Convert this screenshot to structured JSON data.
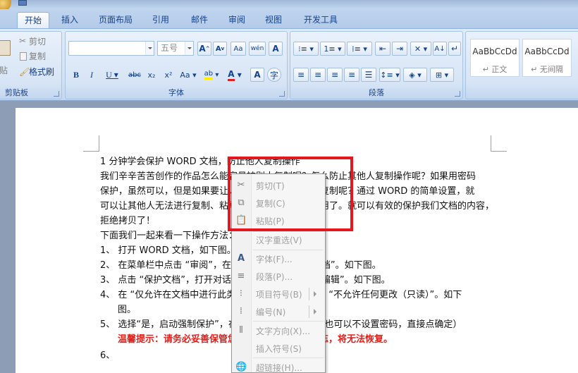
{
  "tabs": [
    {
      "label": "开始",
      "active": true
    },
    {
      "label": "插入"
    },
    {
      "label": "页面布局"
    },
    {
      "label": "引用"
    },
    {
      "label": "邮件"
    },
    {
      "label": "审阅"
    },
    {
      "label": "视图"
    },
    {
      "label": "开发工具"
    }
  ],
  "ribbon": {
    "clipboard": {
      "group_label": "剪贴板",
      "paste_label": "粘贴",
      "cut": "剪切",
      "copy": "复制",
      "format_painter": "格式刷"
    },
    "font": {
      "group_label": "字体",
      "font_name": "",
      "font_size": "五号"
    },
    "paragraph": {
      "group_label": "段落"
    },
    "styles": {
      "normal_preview": "AaBbCcDd",
      "normal_label": "↵ 正文",
      "nospace_preview": "AaBbCcDd",
      "nospace_label": "↵ 无间隔"
    }
  },
  "document": {
    "lines": [
      "1 分钟学会保护 WORD 文档，防止他人复制操作",
      "我们辛辛苦苦创作的作品怎么能容易被别人复制呢？怎么防止其他人复制操作呢？如果用密码",
      "保护，虽然可以，但是如果要让人阅读，但又不允许其复制呢？通过 WORD 的简单设置，就",
      "可以让其他人无法进行复制、粘贴等操作，非常方便实用了。就可以有效的保护我们文档的内容，",
      "拒绝拷贝了！",
      "下面我们一起来看一下操作方法：",
      "1、 打开 WORD 文档，如下图。",
      "2、 在菜单栏中点击 “审阅”，在工具栏中点击 “保护文档”。如下图。",
      "3、 点击 “保护文档”，打开对话框，选择 “限制格式和编辑”。如下图。",
      "4、 在 “仅允许在文档中进行此类编辑” 下拉菜单中选择 “不允许任何更改（只读）”。如下",
      "图。",
      "5、 选择“是，启动强制保护”，在对话框中输入密码。（也可以不设置密码，直接点确定）",
      "温馨提示：请务必妥善保管您设置的密码，如果遗忘，将无法恢复。",
      "6、"
    ]
  },
  "context_menu": {
    "items": [
      {
        "label": "剪切(T)",
        "icon": "scissors-icon"
      },
      {
        "label": "复制(C)",
        "icon": "copy-icon"
      },
      {
        "label": "粘贴(P)",
        "icon": "paste-icon"
      },
      {
        "label": "汉字重选(V)",
        "icon": ""
      },
      {
        "label": "字体(F)...",
        "icon": "font-icon"
      },
      {
        "label": "段落(P)...",
        "icon": "paragraph-icon"
      },
      {
        "label": "项目符号(B)",
        "icon": "bullets-icon",
        "submenu": true
      },
      {
        "label": "编号(N)",
        "icon": "numbering-icon",
        "submenu": true
      },
      {
        "label": "文字方向(X)...",
        "icon": "text-direction-icon"
      },
      {
        "label": "插入符号(S)",
        "icon": ""
      },
      {
        "label": "超链接(H)...",
        "icon": "hyperlink-icon"
      }
    ]
  },
  "colors": {
    "highlight": "#e3171d",
    "ribbon_text": "#15428b",
    "warning_text": "#e0201a"
  }
}
